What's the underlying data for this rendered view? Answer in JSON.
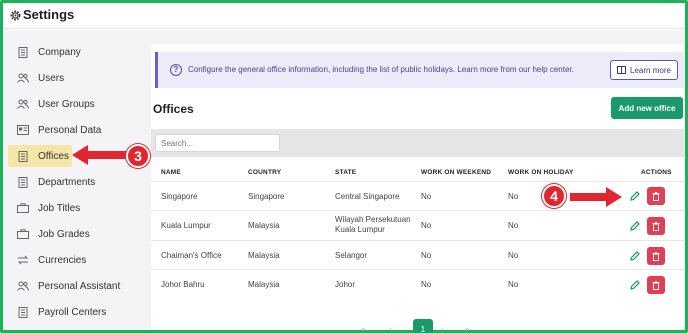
{
  "header": {
    "title": "Settings"
  },
  "sidebar": {
    "items": [
      {
        "label": "Company",
        "icon": "building-icon"
      },
      {
        "label": "Users",
        "icon": "users-icon"
      },
      {
        "label": "User Groups",
        "icon": "user-groups-icon"
      },
      {
        "label": "Personal Data",
        "icon": "id-card-icon"
      },
      {
        "label": "Offices",
        "icon": "office-icon",
        "active": true
      },
      {
        "label": "Departments",
        "icon": "departments-icon"
      },
      {
        "label": "Job Titles",
        "icon": "briefcase-icon"
      },
      {
        "label": "Job Grades",
        "icon": "grades-icon"
      },
      {
        "label": "Currencies",
        "icon": "exchange-icon"
      },
      {
        "label": "Personal Assistant",
        "icon": "assistant-icon"
      },
      {
        "label": "Payroll Centers",
        "icon": "payroll-icon"
      }
    ]
  },
  "banner": {
    "text": "Configure the general office information, including the list of public holidays. Learn more from our help center.",
    "learn_more": "Learn more"
  },
  "offices": {
    "title": "Offices",
    "add_button": "Add new office",
    "search_placeholder": "Search...",
    "columns": [
      "NAME",
      "COUNTRY",
      "STATE",
      "WORK ON WEEKEND",
      "WORK ON HOLIDAY",
      "ACTIONS"
    ],
    "rows": [
      {
        "name": "Singapore",
        "country": "Singapore",
        "state": "Central Singapore",
        "weekend": "No",
        "holiday": "No"
      },
      {
        "name": "Kuala Lumpur",
        "country": "Malaysia",
        "state_line1": "Wilayah Persekutuan",
        "state_line2": "Kuala Lumpur",
        "weekend": "No",
        "holiday": "No"
      },
      {
        "name": "Chaiman's Office",
        "country": "Malaysia",
        "state": "Selangor",
        "weekend": "No",
        "holiday": "No"
      },
      {
        "name": "Johor Bahru",
        "country": "Malaysia",
        "state": "Johor",
        "weekend": "No",
        "holiday": "No"
      }
    ]
  },
  "pagination": {
    "first": "«",
    "prev": "‹",
    "current": "1",
    "next": "›",
    "last": "»"
  },
  "annotations": {
    "step3": "3",
    "step4": "4"
  },
  "colors": {
    "accent": "#1a9a6c",
    "danger": "#e14052",
    "frame": "#1fb15a",
    "active_bg": "#f3e6a6",
    "banner_bg": "#ecebf9",
    "arrow": "#e12630"
  }
}
